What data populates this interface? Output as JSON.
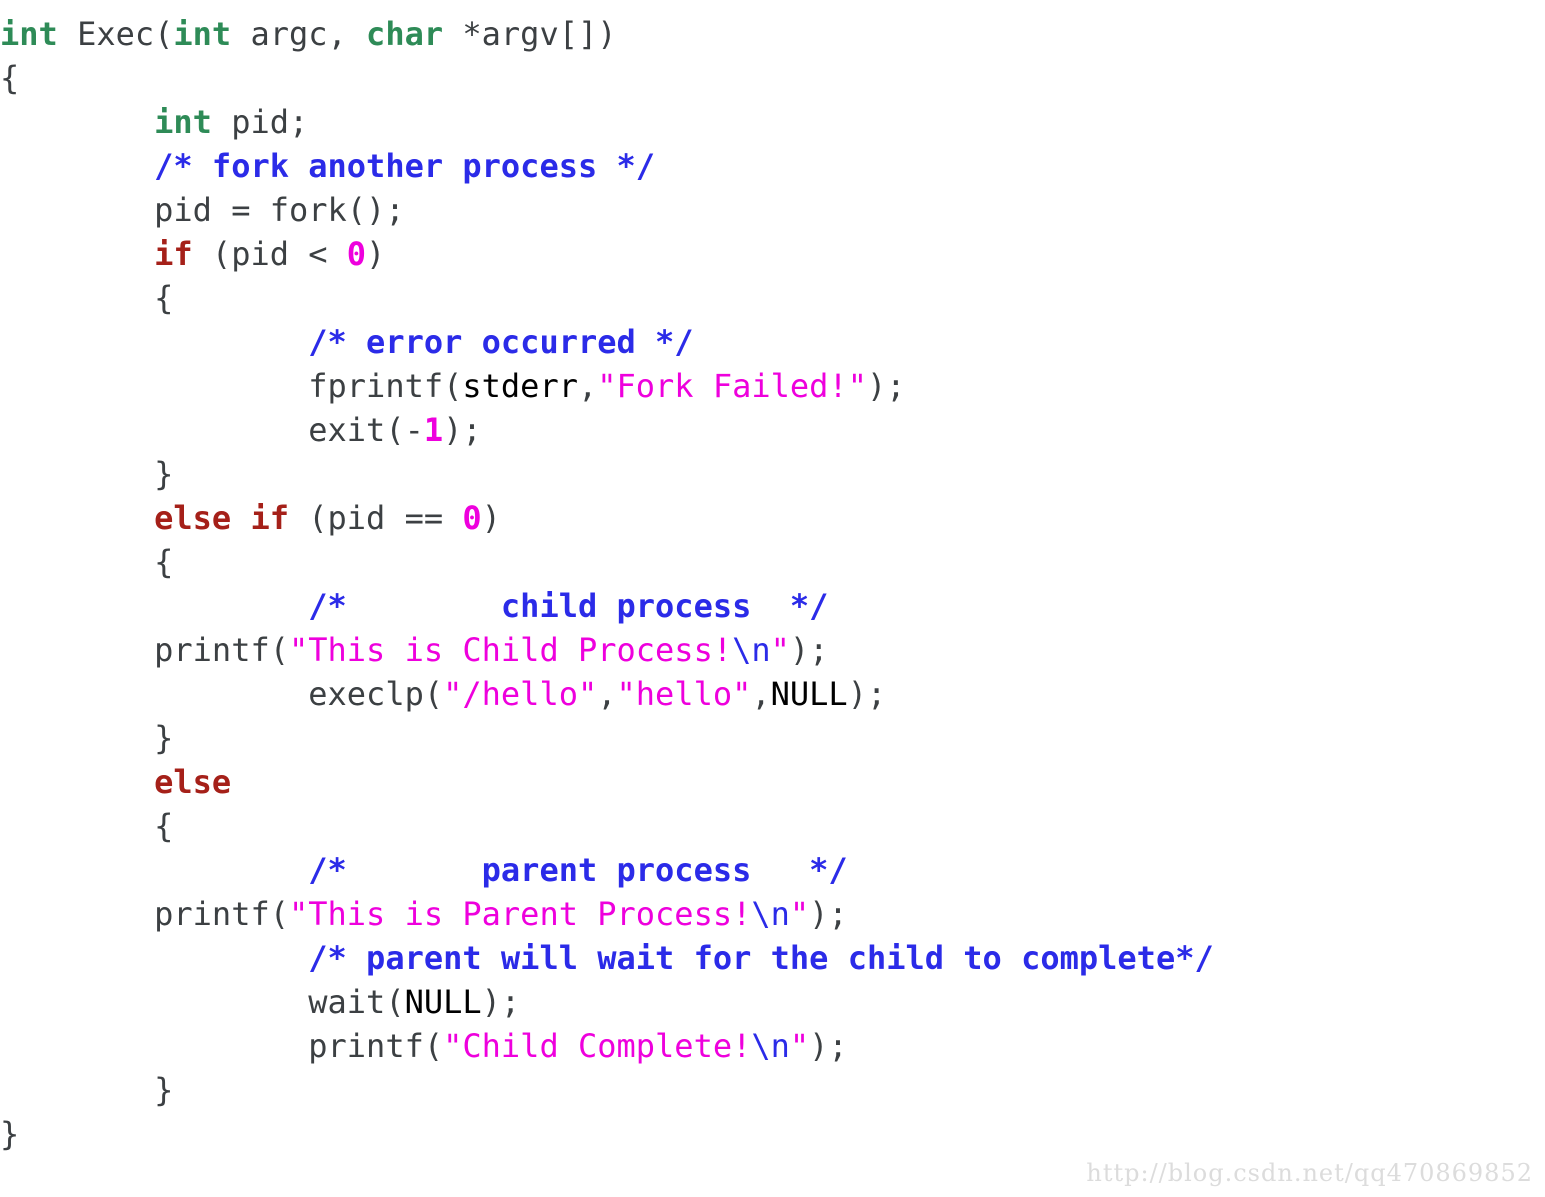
{
  "colors": {
    "background": "#ffffff",
    "plain": "#3c4043",
    "keyword": "#2e8b57",
    "control": "#a52019",
    "comment": "#2b2be8",
    "string": "#ee00dd",
    "number": "#ee00dd",
    "constant": "#ee00dd",
    "escape": "#2b2be8",
    "watermark": "#dcdcdc"
  },
  "watermark": {
    "text": "http://blog.csdn.net/qq470869852"
  },
  "code": {
    "language": "c",
    "lines": [
      {
        "indent": "",
        "tokens": [
          {
            "t": "int",
            "c": "keyword"
          },
          {
            "t": " Exec(",
            "c": "plain"
          },
          {
            "t": "int",
            "c": "keyword"
          },
          {
            "t": " argc, ",
            "c": "plain"
          },
          {
            "t": "char",
            "c": "keyword"
          },
          {
            "t": " *argv[])",
            "c": "plain"
          }
        ]
      },
      {
        "indent": "",
        "tokens": [
          {
            "t": "{",
            "c": "plain"
          }
        ]
      },
      {
        "indent": "        ",
        "tokens": [
          {
            "t": "int",
            "c": "keyword"
          },
          {
            "t": " pid;",
            "c": "plain"
          }
        ]
      },
      {
        "indent": "        ",
        "tokens": [
          {
            "t": "/* fork another process */",
            "c": "comment"
          }
        ]
      },
      {
        "indent": "        ",
        "tokens": [
          {
            "t": "pid = fork();",
            "c": "plain"
          }
        ]
      },
      {
        "indent": "        ",
        "tokens": [
          {
            "t": "if",
            "c": "control"
          },
          {
            "t": " (pid < ",
            "c": "plain"
          },
          {
            "t": "0",
            "c": "number"
          },
          {
            "t": ")",
            "c": "plain"
          }
        ]
      },
      {
        "indent": "        ",
        "tokens": [
          {
            "t": "{",
            "c": "plain"
          }
        ]
      },
      {
        "indent": "                ",
        "tokens": [
          {
            "t": "/* error occurred */",
            "c": "comment"
          }
        ]
      },
      {
        "indent": "                ",
        "tokens": [
          {
            "t": "fprintf(",
            "c": "plain"
          },
          {
            "t": "stderr",
            "c": "constant"
          },
          {
            "t": ",",
            "c": "plain"
          },
          {
            "t": "\"Fork Failed!\"",
            "c": "string"
          },
          {
            "t": ");",
            "c": "plain"
          }
        ]
      },
      {
        "indent": "                ",
        "tokens": [
          {
            "t": "exit(-",
            "c": "plain"
          },
          {
            "t": "1",
            "c": "number"
          },
          {
            "t": ");",
            "c": "plain"
          }
        ]
      },
      {
        "indent": "        ",
        "tokens": [
          {
            "t": "}",
            "c": "plain"
          }
        ]
      },
      {
        "indent": "        ",
        "tokens": [
          {
            "t": "else if",
            "c": "control"
          },
          {
            "t": " (pid == ",
            "c": "plain"
          },
          {
            "t": "0",
            "c": "number"
          },
          {
            "t": ")",
            "c": "plain"
          }
        ]
      },
      {
        "indent": "        ",
        "tokens": [
          {
            "t": "{",
            "c": "plain"
          }
        ]
      },
      {
        "indent": "                ",
        "tokens": [
          {
            "t": "/*        child process  */",
            "c": "comment"
          }
        ]
      },
      {
        "indent": "        ",
        "tokens": [
          {
            "t": "printf(",
            "c": "plain"
          },
          {
            "t": "\"This is Child Process!",
            "c": "string"
          },
          {
            "t": "\\n",
            "c": "escape"
          },
          {
            "t": "\"",
            "c": "string"
          },
          {
            "t": ");",
            "c": "plain"
          }
        ]
      },
      {
        "indent": "                ",
        "tokens": [
          {
            "t": "execlp(",
            "c": "plain"
          },
          {
            "t": "\"/hello\"",
            "c": "string"
          },
          {
            "t": ",",
            "c": "plain"
          },
          {
            "t": "\"hello\"",
            "c": "string"
          },
          {
            "t": ",",
            "c": "plain"
          },
          {
            "t": "NULL",
            "c": "constant"
          },
          {
            "t": ");",
            "c": "plain"
          }
        ]
      },
      {
        "indent": "        ",
        "tokens": [
          {
            "t": "}",
            "c": "plain"
          }
        ]
      },
      {
        "indent": "        ",
        "tokens": [
          {
            "t": "else",
            "c": "control"
          }
        ]
      },
      {
        "indent": "        ",
        "tokens": [
          {
            "t": "{",
            "c": "plain"
          }
        ]
      },
      {
        "indent": "                ",
        "tokens": [
          {
            "t": "/*       parent process   */",
            "c": "comment"
          }
        ]
      },
      {
        "indent": "        ",
        "tokens": [
          {
            "t": "printf(",
            "c": "plain"
          },
          {
            "t": "\"This is Parent Process!",
            "c": "string"
          },
          {
            "t": "\\n",
            "c": "escape"
          },
          {
            "t": "\"",
            "c": "string"
          },
          {
            "t": ");",
            "c": "plain"
          }
        ]
      },
      {
        "indent": "                ",
        "tokens": [
          {
            "t": "/* parent will wait for the child to complete*/",
            "c": "comment"
          }
        ]
      },
      {
        "indent": "                ",
        "tokens": [
          {
            "t": "wait(",
            "c": "plain"
          },
          {
            "t": "NULL",
            "c": "constant"
          },
          {
            "t": ");",
            "c": "plain"
          }
        ]
      },
      {
        "indent": "                ",
        "tokens": [
          {
            "t": "printf(",
            "c": "plain"
          },
          {
            "t": "\"Child Complete!",
            "c": "string"
          },
          {
            "t": "\\n",
            "c": "escape"
          },
          {
            "t": "\"",
            "c": "string"
          },
          {
            "t": ");",
            "c": "plain"
          }
        ]
      },
      {
        "indent": "        ",
        "tokens": [
          {
            "t": "}",
            "c": "plain"
          }
        ]
      },
      {
        "indent": "",
        "tokens": [
          {
            "t": "}",
            "c": "plain"
          }
        ]
      }
    ]
  }
}
